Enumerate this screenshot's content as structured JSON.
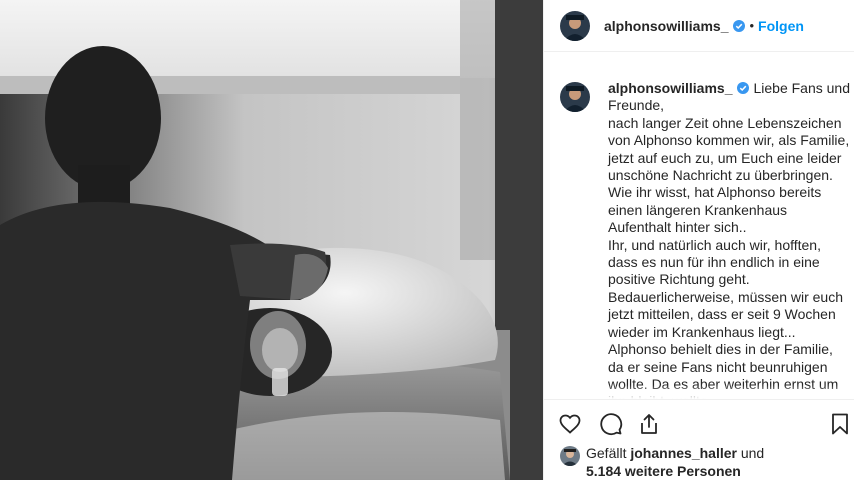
{
  "header": {
    "username": "alphonsowilliams_",
    "separator": "•",
    "follow_label": "Folgen"
  },
  "caption": {
    "username": "alphonsowilliams_",
    "lines": [
      "Liebe Fans und Freunde,",
      "nach langer Zeit ohne Lebenszeichen von Alphonso kommen wir, als Familie, jetzt auf euch zu, um Euch eine leider unschöne Nachricht zu überbringen.",
      "Wie ihr wisst, hat Alphonso bereits einen längeren Krankenhaus Aufenthalt hinter sich..",
      "Ihr, und natürlich auch wir, hofften, dass es nun für ihn endlich in eine positive Richtung geht.",
      "Bedauerlicherweise, müssen wir euch jetzt mitteilen, dass er seit 9 Wochen wieder im Krankenhaus liegt... Alphonso behielt dies in der Familie, da er seine Fans nicht beunruhigen wollte. Da es aber weiterhin ernst um ihn bleibt, wollte"
    ]
  },
  "likes": {
    "prefix": "Gefällt",
    "user": "johannes_haller",
    "connector": "und",
    "others": "5.184 weitere Personen"
  },
  "icons": [
    "verified-badge-icon",
    "heart-icon",
    "comment-icon",
    "share-icon",
    "bookmark-icon"
  ],
  "colors": {
    "link": "#0095f6",
    "verified": "#3897f0",
    "text": "#262626",
    "divider": "#efefef"
  }
}
